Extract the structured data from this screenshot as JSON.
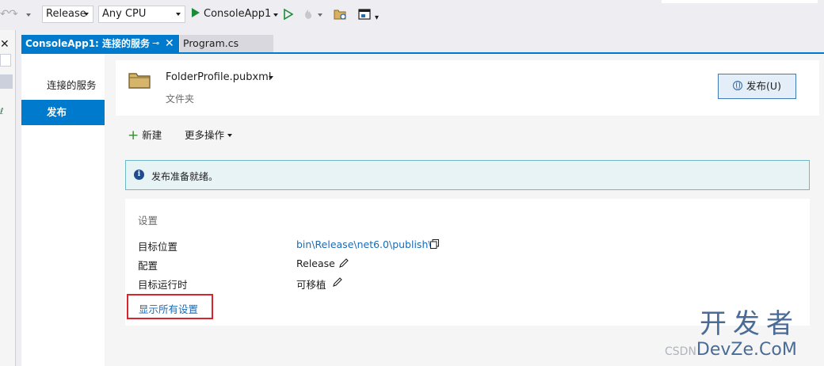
{
  "toolbar": {
    "configuration": "Release",
    "platform": "Any CPU",
    "run_target": "ConsoleApp1"
  },
  "tabs": [
    {
      "label": "ConsoleApp1: 连接的服务",
      "active": true
    },
    {
      "label": "Program.cs",
      "active": false
    }
  ],
  "nav": {
    "items": [
      {
        "label": "连接的服务",
        "selected": false
      },
      {
        "label": "发布",
        "selected": true
      }
    ]
  },
  "profile": {
    "name": "FolderProfile.pubxml",
    "type": "文件夹",
    "publish_button": "发布(U)"
  },
  "actions": {
    "new_label": "新建",
    "more_label": "更多操作"
  },
  "info": {
    "message": "发布准备就绪。"
  },
  "settings": {
    "title": "设置",
    "rows": [
      {
        "label": "目标位置",
        "value": "bin\\Release\\net6.0\\publish\\"
      },
      {
        "label": "配置",
        "value": "Release"
      },
      {
        "label": "目标运行时",
        "value": "可移植"
      }
    ],
    "show_all_label": "显示所有设置"
  },
  "watermark": {
    "line1": "开发者",
    "line2": "DevZe.CoM",
    "faint": "CSDN"
  },
  "colors": {
    "accent": "#007acc",
    "link": "#1a6bb5",
    "highlight_border": "#d9242c",
    "info_border": "#6cb9c4"
  }
}
